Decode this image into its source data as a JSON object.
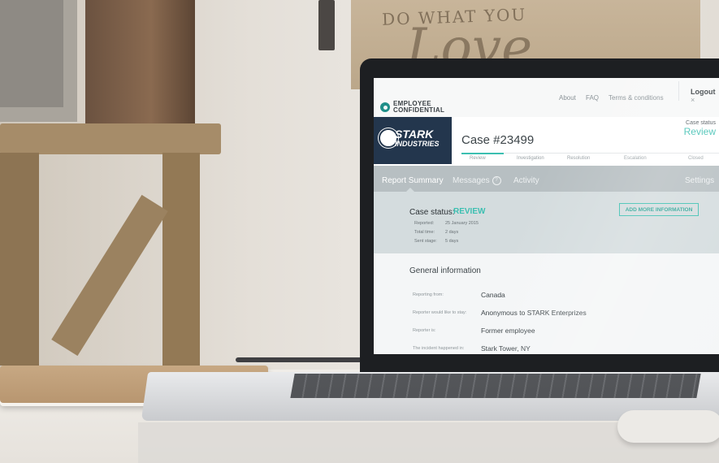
{
  "background": {
    "wall_sign_text": "DO WHAT YOU",
    "wall_sign_script": "Love"
  },
  "app": {
    "brand": {
      "line1": "EMPLOYEE",
      "line2": "CONFIDENTIAL"
    },
    "nav": {
      "about": "About",
      "faq": "FAQ",
      "terms": "Terms & conditions",
      "logout": "Logout",
      "logout_icon": "×"
    },
    "company_logo": {
      "line1": "STARK",
      "line2": "INDUSTRIES"
    },
    "case": {
      "title": "Case #23499",
      "status_label": "Case status",
      "status_value": "Review",
      "steps": [
        "Review",
        "Investigation",
        "Resolution",
        "Escalation",
        "Closed"
      ]
    },
    "tabs": {
      "report_summary": "Report Summary",
      "messages": "Messages",
      "messages_badge": "?",
      "activity": "Activity",
      "settings": "Settings"
    },
    "summary": {
      "status_label": "Case status:",
      "status_value": "REVIEW",
      "add_button": "ADD MORE INFORMATION",
      "meta": [
        {
          "label": "Reported:",
          "value": "25 January 2015"
        },
        {
          "label": "Total time:",
          "value": "2 days"
        },
        {
          "label": "Sent stage:",
          "value": "5 days"
        }
      ]
    },
    "general": {
      "title": "General information",
      "rows": [
        {
          "label": "Reporting from:",
          "value": "Canada"
        },
        {
          "label": "Reporter would like to stay:",
          "value": "Anonymous to STARK Enterprizes"
        },
        {
          "label": "Reporter is:",
          "value": "Former employee"
        },
        {
          "label": "The incident happened in:",
          "value": "Stark Tower, NY"
        }
      ]
    }
  },
  "colors": {
    "accent": "#3cbfb1",
    "navy": "#23364d",
    "tabbar": "#b7bfc2",
    "summary_bg": "#d4dcde"
  }
}
